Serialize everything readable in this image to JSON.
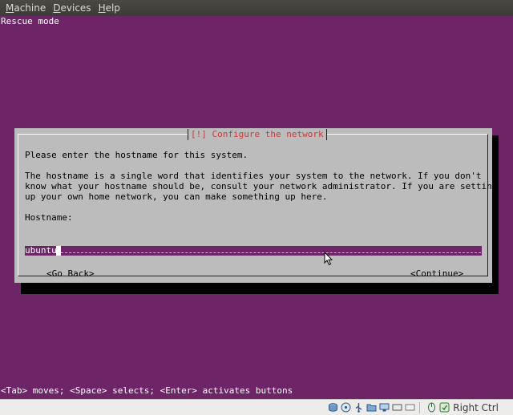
{
  "menubar": {
    "items": [
      {
        "mnemonic": "M",
        "rest": "achine"
      },
      {
        "mnemonic": "D",
        "rest": "evices"
      },
      {
        "mnemonic": "H",
        "rest": "elp"
      }
    ]
  },
  "screen": {
    "title": "Rescue mode",
    "help": "<Tab> moves; <Space> selects; <Enter> activates buttons"
  },
  "dialog": {
    "title": "[!] Configure the network",
    "prompt": "Please enter the hostname for this system.",
    "description_lines": [
      "The hostname is a single word that identifies your system to the network. If you don't",
      "know what your hostname should be, consult your network administrator. If you are setting",
      "up your own home network, you can make something up here."
    ],
    "field_label": "Hostname:",
    "hostname_value": "ubuntu",
    "back_button": "<Go Back>",
    "continue_button": "<Continue>"
  },
  "statusbar": {
    "icons": [
      "hard-disk-icon",
      "optical-drive-icon",
      "usb-icon",
      "shared-folders-icon",
      "network-icon",
      "display-icon",
      "video-capture-icon",
      "mouse-integration-icon",
      "keyboard-capture-icon"
    ],
    "host_key": "Right Ctrl"
  },
  "colors": {
    "screen_background": "#6e2567",
    "dialog_background": "#bcbcbc",
    "dialog_title": "#c83a3a"
  }
}
